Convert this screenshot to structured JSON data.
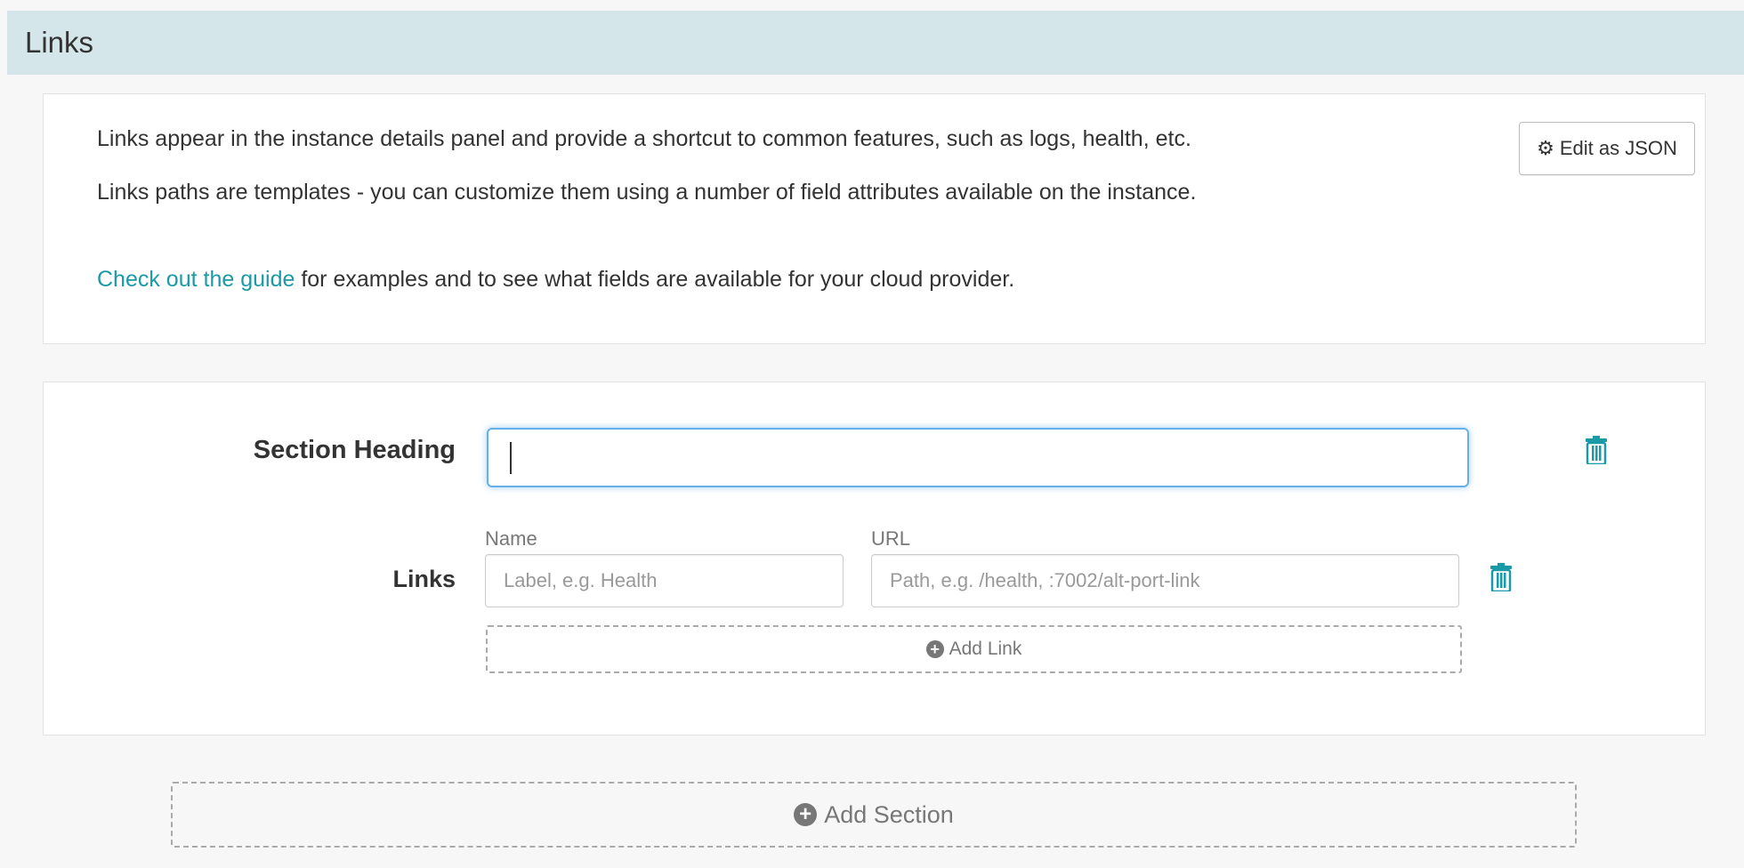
{
  "header": {
    "title": "Links"
  },
  "info": {
    "line1": "Links appear in the instance details panel and provide a shortcut to common features, such as logs, health, etc.",
    "line2": "Links paths are templates - you can customize them using a number of field attributes available on the instance.",
    "guide_link": "Check out the guide",
    "line3_rest": " for examples and to see what fields are available for your cloud provider.",
    "edit_json_label": "Edit as JSON"
  },
  "section": {
    "heading_label": "Section Heading",
    "heading_value": "",
    "links_label": "Links",
    "name_col": "Name",
    "url_col": "URL",
    "name_placeholder": "Label, e.g. Health",
    "url_placeholder": "Path, e.g. /health, :7002/alt-port-link",
    "add_link_label": "Add Link"
  },
  "add_section_label": "Add Section",
  "icons": {
    "edit_json": "gear-icon",
    "delete_section": "trash-icon",
    "delete_link": "trash-icon",
    "add_link": "plus-circle-icon",
    "add_section": "plus-circle-icon"
  },
  "colors": {
    "header_bg": "#d5e6eb",
    "accent": "#1a9aa6",
    "focus_border": "#66afe9"
  }
}
